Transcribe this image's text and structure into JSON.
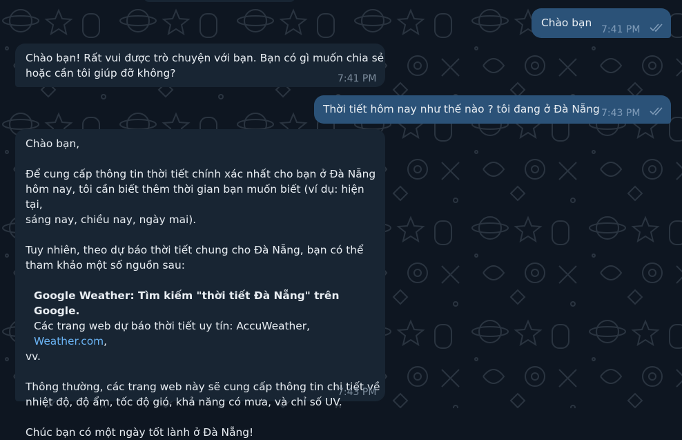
{
  "chat": {
    "messages": [
      {
        "id": "m1",
        "direction": "out",
        "text": "Chào bạn",
        "time": "7:41 PM",
        "status": "read"
      },
      {
        "id": "m2",
        "direction": "in",
        "text_line1": "Chào bạn! Rất vui được trò chuyện với bạn. Bạn có gì muốn chia sẻ",
        "text_line2": "hoặc cần tôi giúp đỡ không?",
        "time": "7:41 PM"
      },
      {
        "id": "m3",
        "direction": "out",
        "text": "Thời tiết hôm nay như thế nào ? tôi đang ở Đà Nẵng",
        "time": "7:43 PM",
        "status": "read"
      },
      {
        "id": "m4",
        "direction": "in",
        "time": "7:43 PM",
        "greeting": "Chào bạn,",
        "para1_line1": "Để cung cấp thông tin thời tiết chính xác nhất cho bạn ở Đà Nẵng",
        "para1_line2": "hôm nay, tôi cần biết thêm thời gian bạn muốn biết (ví dụ: hiện tại,",
        "para1_line3": "sáng nay, chiều nay, ngày mai).",
        "para2_line1": "Tuy nhiên, theo dự báo thời tiết chung cho Đà Nẵng, bạn có thể",
        "para2_line2": "tham khảo một số nguồn sau:",
        "source1": "Google Weather: Tìm kiếm \"thời tiết Đà Nẵng\" trên Google.",
        "source2_prefix": "Các trang web dự báo thời tiết uy tín: AccuWeather, ",
        "source2_link": "Weather.com",
        "source2_suffix": ",",
        "source2_line2": "vv.",
        "para3_line1": "Thông thường, các trang web này sẽ cung cấp thông tin chi tiết về",
        "para3_line2": "nhiệt độ, độ ẩm, tốc độ gió, khả năng có mưa, và chỉ số UV.",
        "closing": "Chúc bạn có một ngày tốt lành ở Đà Nẵng!"
      }
    ]
  },
  "colors": {
    "background": "#0e1621",
    "incoming_bubble": "#182533",
    "outgoing_bubble": "#2b5278",
    "link": "#6ab3f3",
    "timestamp": "#7d8d9d"
  },
  "icons": {
    "read_receipt": "double-check-icon",
    "background": "star-wars-doodle-pattern"
  }
}
